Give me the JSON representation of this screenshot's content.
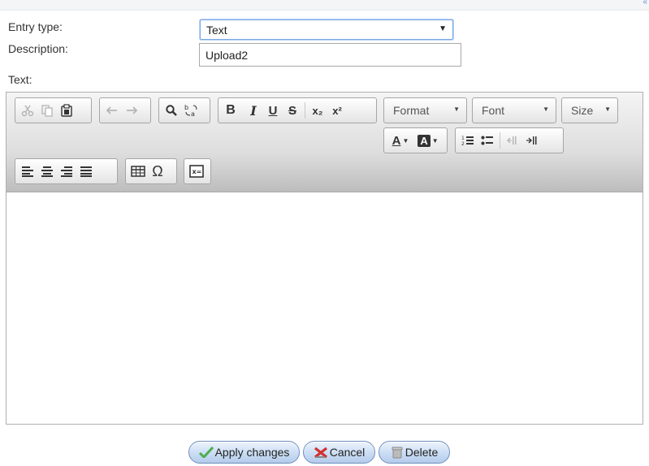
{
  "form": {
    "entry_type_label": "Entry type:",
    "entry_type_value": "Text",
    "description_label": "Description:",
    "description_value": "Upload2",
    "text_label": "Text:"
  },
  "toolbar": {
    "groups": [
      [
        "cut-icon",
        "copy-icon",
        "paste-icon"
      ],
      [
        "undo-icon",
        "redo-icon"
      ],
      [
        "find-icon",
        "replace-icon"
      ],
      [
        "bold-icon",
        "italic-icon",
        "underline-icon",
        "strikethrough-icon",
        "subscript-icon",
        "superscript-icon"
      ],
      [
        "text-color-icon",
        "background-color-icon"
      ],
      [
        "numbered-list-icon",
        "bulleted-list-icon",
        "decrease-indent-icon",
        "increase-indent-icon"
      ],
      [
        "align-left-icon",
        "align-center-icon",
        "align-right-icon",
        "justify-icon"
      ],
      [
        "table-icon",
        "special-character-icon"
      ],
      [
        "equation-icon"
      ]
    ],
    "format_label": "Format",
    "font_label": "Font",
    "size_label": "Size",
    "glyphs": {
      "bold": "B",
      "italic": "I",
      "underline": "U",
      "strike": "S",
      "sub": "x₂",
      "sup": "x²",
      "text_color": "A",
      "bg_color": "A",
      "omega": "Ω"
    }
  },
  "editor": {
    "content": ""
  },
  "buttons": {
    "apply": "Apply changes",
    "cancel": "Cancel",
    "delete": "Delete"
  },
  "colors": {
    "toolbar_top": "#f4f4f4",
    "toolbar_bottom": "#bdbdbd",
    "button_blue": "#cddff5",
    "apply_icon": "#4caf50",
    "cancel_icon": "#d32f2f"
  }
}
